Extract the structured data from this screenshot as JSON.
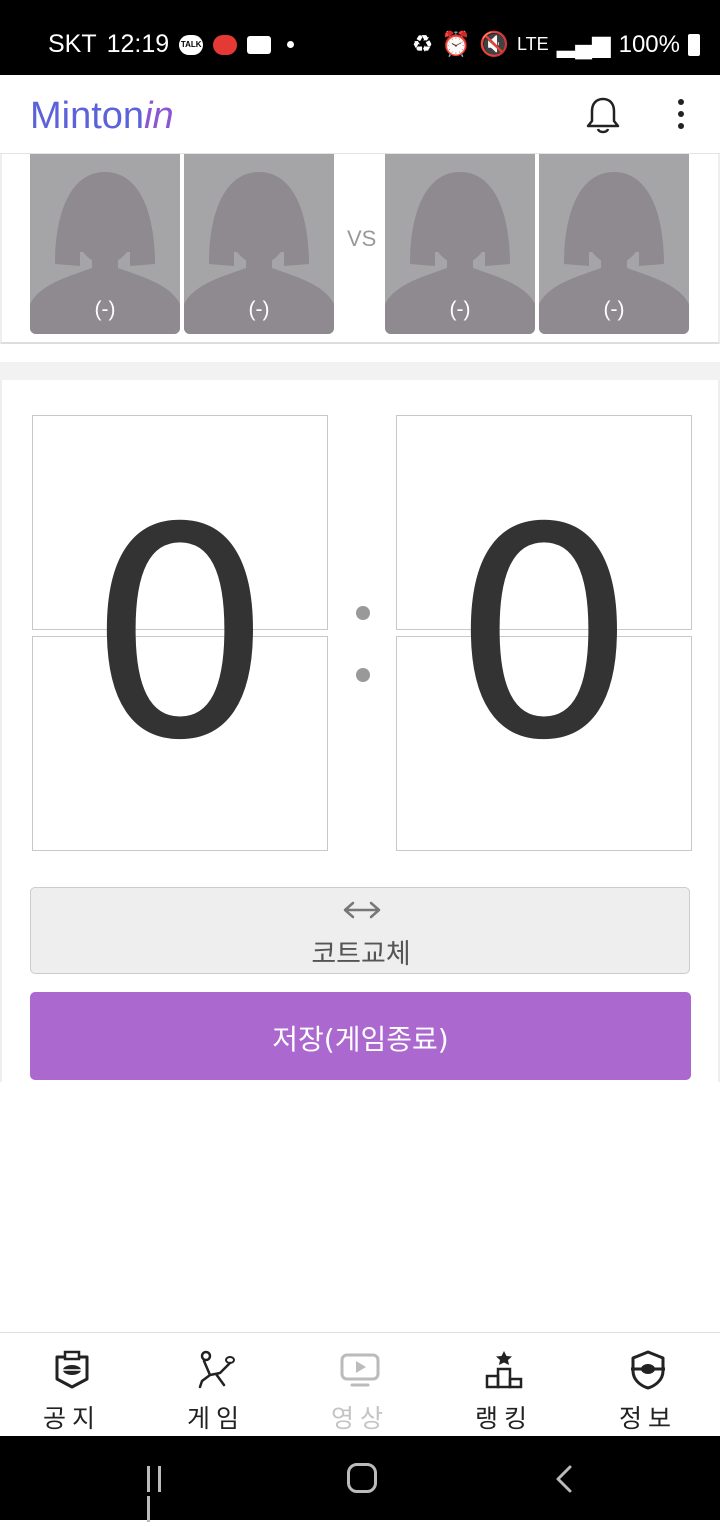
{
  "status_bar": {
    "carrier": "SKT",
    "time": "12:19",
    "talk_badge": "TALK",
    "network": "LTE",
    "battery": "100%"
  },
  "header": {
    "logo_main": "Minton",
    "logo_suffix": "in",
    "notification_icon": "bell-icon",
    "menu_icon": "more-vertical-icon"
  },
  "match": {
    "team_left": [
      {
        "label": "(-)"
      },
      {
        "label": "(-)"
      }
    ],
    "vs_label": "VS",
    "team_right": [
      {
        "label": "(-)"
      },
      {
        "label": "(-)"
      }
    ]
  },
  "scoreboard": {
    "left_score": "0",
    "right_score": "0"
  },
  "actions": {
    "swap_icon": "left-right-arrow-icon",
    "court_change_label": "코트교체",
    "save_label": "저장(게임종료)",
    "save_color": "#ab69cf"
  },
  "tabs": [
    {
      "label": "공지",
      "icon": "notice-badge-icon",
      "enabled": true
    },
    {
      "label": "게임",
      "icon": "badminton-player-icon",
      "enabled": true
    },
    {
      "label": "영상",
      "icon": "video-play-icon",
      "enabled": false
    },
    {
      "label": "랭킹",
      "icon": "podium-icon",
      "enabled": true
    },
    {
      "label": "정보",
      "icon": "shield-info-icon",
      "enabled": true
    }
  ],
  "system_nav": [
    "recents-icon",
    "home-icon",
    "back-icon"
  ]
}
